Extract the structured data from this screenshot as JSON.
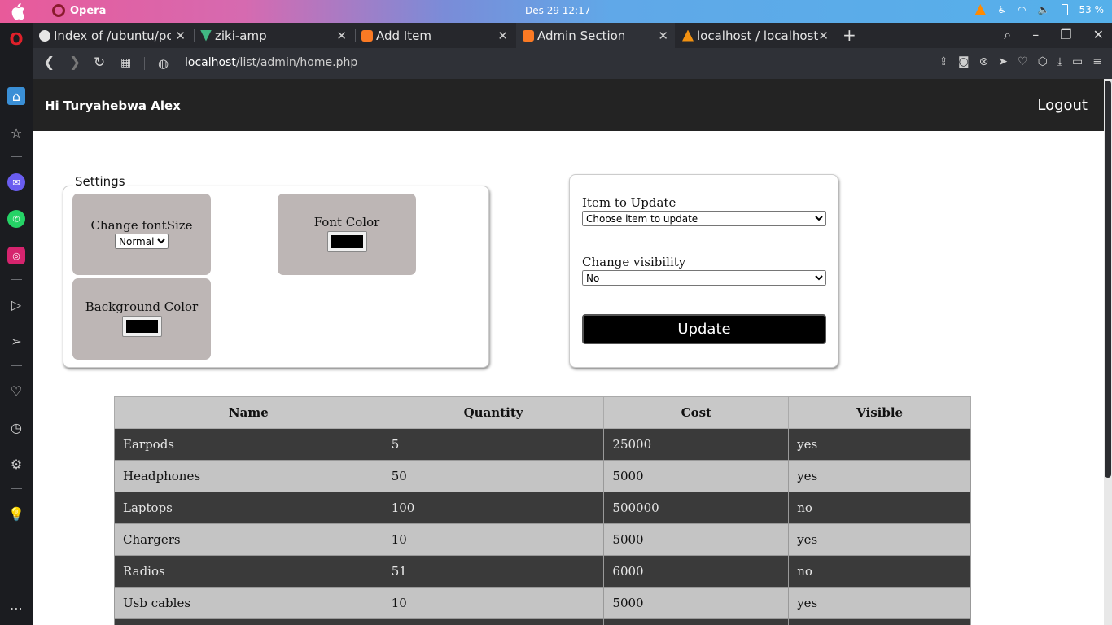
{
  "os": {
    "app_name": "Opera",
    "clock": "Des 29  12:17",
    "battery": "53 %"
  },
  "tabs": [
    {
      "title": "Index of /ubuntu/po",
      "favicon_color": "#e6e6e6",
      "active": false
    },
    {
      "title": "ziki-amp",
      "favicon_color": "#41b883",
      "active": false
    },
    {
      "title": "Add Item",
      "favicon_color": "#fb7a24",
      "active": false
    },
    {
      "title": "Admin Section",
      "favicon_color": "#fb7a24",
      "active": true
    },
    {
      "title": "localhost / localhost /",
      "favicon_color": "#f29111",
      "active": false
    }
  ],
  "address": {
    "host": "localhost",
    "path": "/list/admin/home.php"
  },
  "header": {
    "greeting": "Hi Turyahebwa Alex",
    "logout": "Logout"
  },
  "settings": {
    "legend": "Settings",
    "font_size_label": "Change fontSize",
    "font_size_value": "Normal",
    "font_color_label": "Font Color",
    "bg_color_label": "Background Color",
    "font_color": "#000000",
    "bg_color": "#000000"
  },
  "update_form": {
    "item_label": "Item to Update",
    "item_placeholder": "Choose item to update",
    "visibility_label": "Change visibility",
    "visibility_value": "No",
    "button_label": "Update"
  },
  "table": {
    "headers": [
      "Name",
      "Quantity",
      "Cost",
      "Visible"
    ],
    "rows": [
      [
        "Earpods",
        "5",
        "25000",
        "yes"
      ],
      [
        "Headphones",
        "50",
        "5000",
        "yes"
      ],
      [
        "Laptops",
        "100",
        "500000",
        "no"
      ],
      [
        "Chargers",
        "10",
        "5000",
        "yes"
      ],
      [
        "Radios",
        "51",
        "6000",
        "no"
      ],
      [
        "Usb cables",
        "10",
        "5000",
        "yes"
      ]
    ]
  },
  "colors": {
    "header_bg": "#232323",
    "tile_bg": "#bdb6b5",
    "row_dark": "#3a3a3a",
    "row_light": "#c4c4c4"
  }
}
